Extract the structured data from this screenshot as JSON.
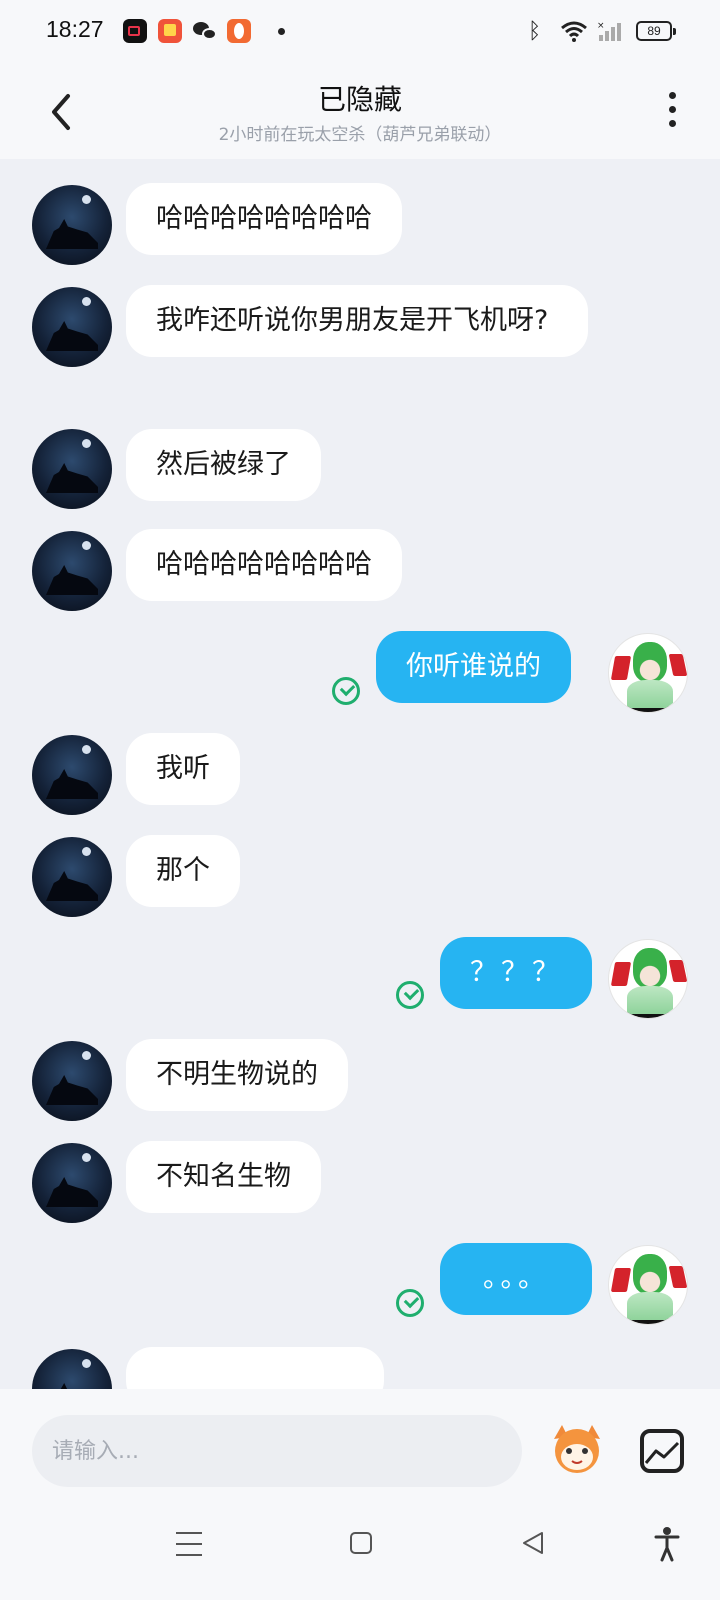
{
  "status_bar": {
    "time": "18:27",
    "battery": "89",
    "bluetooth_icon": "bluetooth-icon",
    "wifi_icon": "wifi-icon",
    "signal_icon": "signal-icon"
  },
  "header": {
    "title": "已隐藏",
    "subtitle": "2小时前在玩太空杀（葫芦兄弟联动）",
    "back_icon": "chevron-left-icon",
    "more_icon": "more-vertical-icon"
  },
  "messages": [
    {
      "side": "in",
      "text": "哈哈哈哈哈哈哈哈"
    },
    {
      "side": "in",
      "text": "我咋还听说你男朋友是开飞机呀?"
    },
    {
      "side": "in",
      "text": "然后被绿了"
    },
    {
      "side": "in",
      "text": "哈哈哈哈哈哈哈哈"
    },
    {
      "side": "out",
      "text": "你听谁说的"
    },
    {
      "side": "in",
      "text": "我听"
    },
    {
      "side": "in",
      "text": "那个"
    },
    {
      "side": "out",
      "text": "？？？"
    },
    {
      "side": "in",
      "text": "不明生物说的"
    },
    {
      "side": "in",
      "text": "不知名生物"
    },
    {
      "side": "out",
      "text": "。。。"
    }
  ],
  "input": {
    "placeholder": "请输入..."
  },
  "colors": {
    "outgoing_bubble": "#26b4f2",
    "incoming_bubble": "#ffffff",
    "read_check": "#1fae6e",
    "background": "#eef0f5"
  }
}
